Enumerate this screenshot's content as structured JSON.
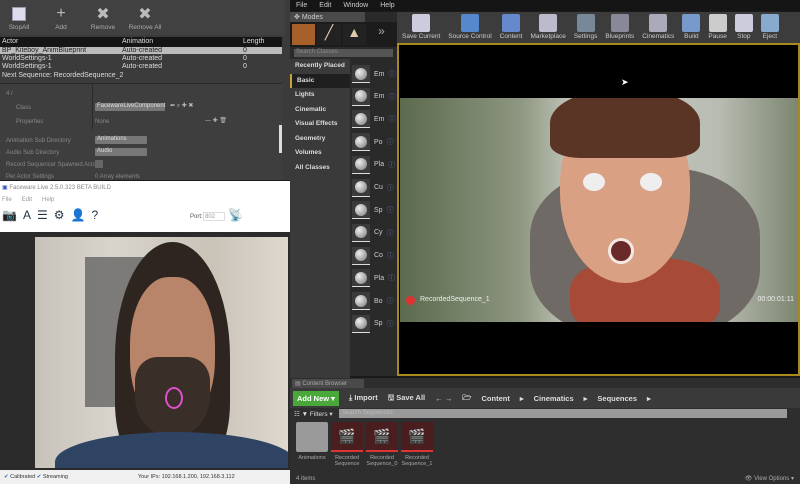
{
  "recorder": {
    "toolbar": [
      {
        "label": "StopAll",
        "icon": "stop-icon"
      },
      {
        "label": "Add",
        "icon": "add-icon"
      },
      {
        "label": "Remove",
        "icon": "remove-icon"
      },
      {
        "label": "Remove All",
        "icon": "remove-all-icon"
      }
    ],
    "columns": [
      "Actor",
      "Animation",
      "Length"
    ],
    "rows": [
      [
        "BP_Kiteboy_AnimBlueprint",
        "Auto-created",
        "0"
      ],
      [
        "WorldSettings-1",
        "Auto-created",
        "0"
      ],
      [
        "WorldSettings-1",
        "Auto-created",
        "0"
      ]
    ],
    "next_sequence": "Next Sequence: RecordedSequence_2",
    "props": {
      "index": "4 /",
      "class_label": "Class",
      "class_value": "FacewareLiveComponent",
      "properties_label": "Properties",
      "properties_value": "None",
      "anim_dir_label": "Animation Sub Directory",
      "anim_dir_value": "Animations",
      "audio_dir_label": "Audio Sub Directory",
      "audio_dir_value": "Audio",
      "record_spawned_label": "Record Sequencer Spawned Actors",
      "per_actor_label": "Per Actor Settings",
      "per_actor_value": "0 Array elements"
    }
  },
  "faceware": {
    "title": "Faceware Live 2.5.0.323 BETA BUILD",
    "menu": [
      "File",
      "Edit",
      "Help"
    ],
    "port_label": "Port:",
    "port_value": "802",
    "status": {
      "calibrated": "Calibrated",
      "streaming": "Streaming",
      "ip": "Your IPs: 192.168.1.200, 192.168.3.112"
    }
  },
  "ue": {
    "menu": [
      "File",
      "Edit",
      "Window",
      "Help"
    ],
    "modes_tab": "Modes",
    "search_placeholder": "Search Classes",
    "categories": [
      "Recently Placed",
      "Basic",
      "Lights",
      "Cinematic",
      "Visual Effects",
      "Geometry",
      "Volumes",
      "All Classes"
    ],
    "active_category": "Basic",
    "items": [
      "Em",
      "Em",
      "Em",
      "Po",
      "Pla",
      "Cu",
      "Sp",
      "Cy",
      "Co",
      "Pla",
      "Bo",
      "Sp"
    ],
    "toolbar": [
      "Save Current",
      "Source Control",
      "Content",
      "Marketplace",
      "Settings",
      "Blueprints",
      "Cinematics",
      "Build",
      "Pause",
      "Stop",
      "Eject"
    ],
    "viewport": {
      "sequence": "RecordedSequence_1",
      "timecode": "00:00:01:11"
    },
    "content_browser": {
      "tab": "Content Browser",
      "add_new": "Add New",
      "import": "Import",
      "save_all": "Save All",
      "path": [
        "Content",
        "Cinematics",
        "Sequences"
      ],
      "filters": "Filters",
      "search_placeholder": "Search Sequences",
      "assets": [
        "Animations",
        "Recorded Sequence",
        "Recorded Sequence_0",
        "Recorded Sequence_1"
      ],
      "count": "4 items",
      "view_options": "View Options"
    }
  },
  "colors": {
    "accent_green": "#4aa83a",
    "viewport_border": "#a8891f",
    "record_red": "#e03030"
  }
}
